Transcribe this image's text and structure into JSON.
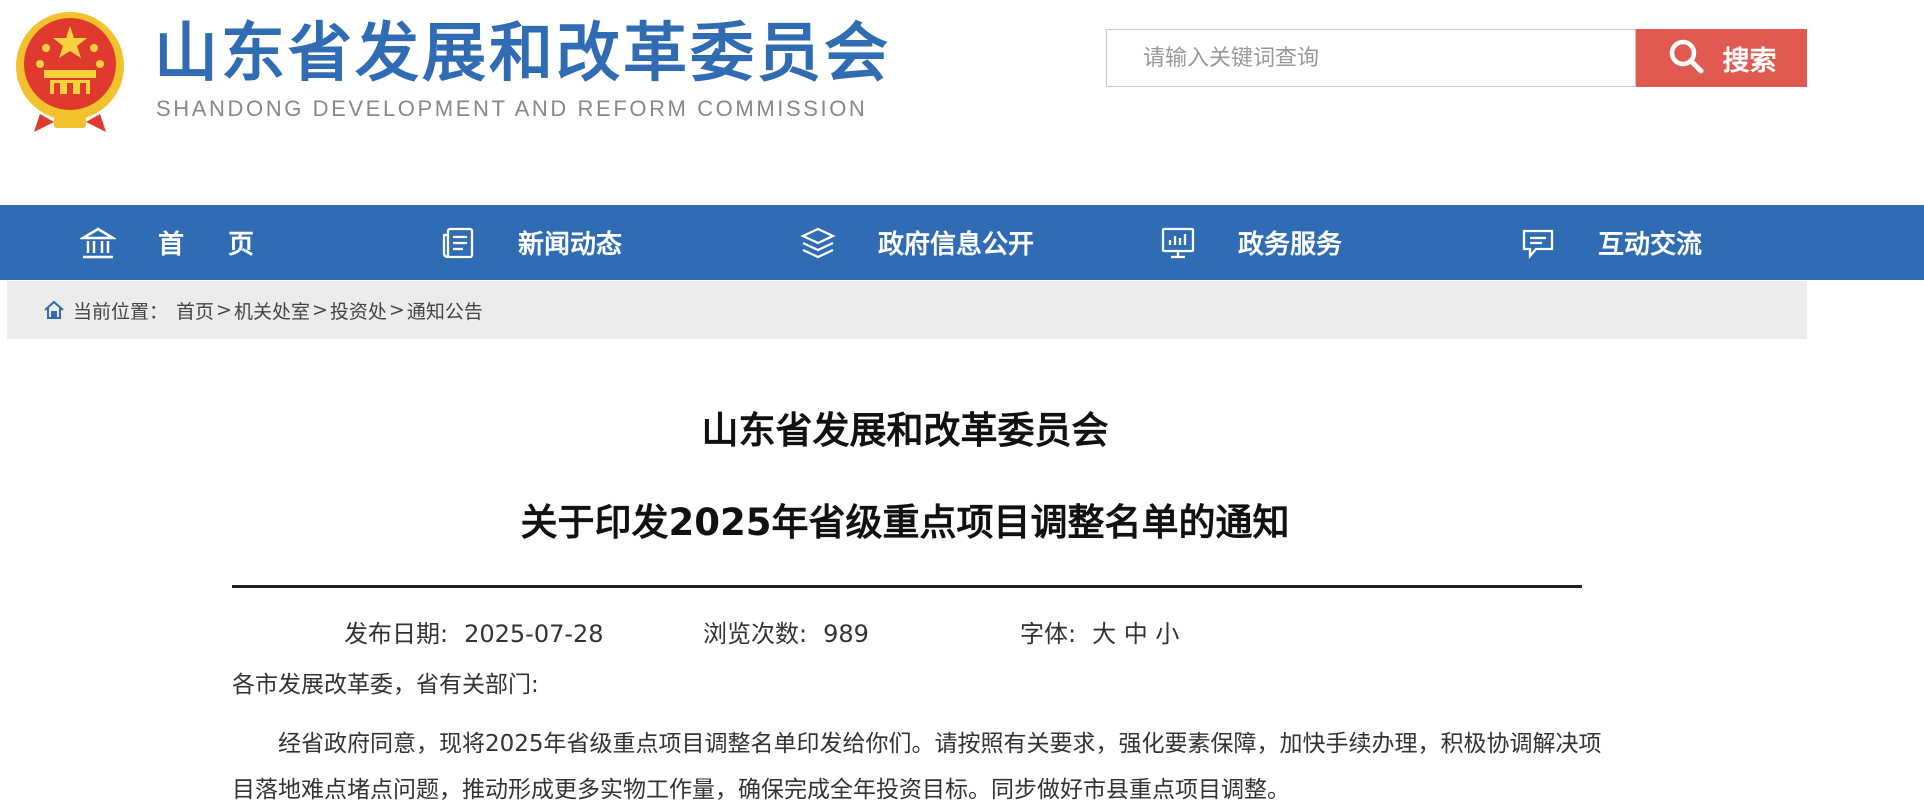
{
  "header": {
    "title_cn": "山东省发展和改革委员会",
    "title_en": "SHANDONG DEVELOPMENT AND REFORM COMMISSION",
    "emblem_icon": "national-emblem-icon",
    "search": {
      "placeholder": "请输入关键词查询",
      "value": "",
      "button_label": "搜索",
      "button_color": "#e05a52"
    }
  },
  "nav": {
    "color": "#2f6cb3",
    "items": [
      {
        "label": "首页",
        "icon": "home-icon"
      },
      {
        "label": "新闻动态",
        "icon": "news-icon"
      },
      {
        "label": "政府信息公开",
        "icon": "layers-icon"
      },
      {
        "label": "政务服务",
        "icon": "chart-board-icon"
      },
      {
        "label": "互动交流",
        "icon": "chat-icon"
      }
    ]
  },
  "breadcrumb": {
    "prefix": "当前位置：",
    "items": [
      "首页",
      "机关处室",
      "投资处",
      "通知公告"
    ],
    "separator": ">"
  },
  "article": {
    "title_line1": "山东省发展和改革委员会",
    "title_line2": "关于印发2025年省级重点项目调整名单的通知",
    "meta": {
      "date_label": "发布日期:",
      "date_value": "2025-07-28",
      "views_label": "浏览次数:",
      "views_value": "989",
      "font_label": "字体:",
      "font_sizes": [
        "大",
        "中",
        "小"
      ]
    },
    "salutation": "各市发展改革委，省有关部门:",
    "body_line1": "经省政府同意，现将2025年省级重点项目调整名单印发给你们。请按照有关要求，强化要素保障，加快手续办理，积极协调解决项",
    "body_line2": "目落地难点堵点问题，推动形成更多实物工作量，确保完成全年投资目标。同步做好市县重点项目调整。"
  }
}
